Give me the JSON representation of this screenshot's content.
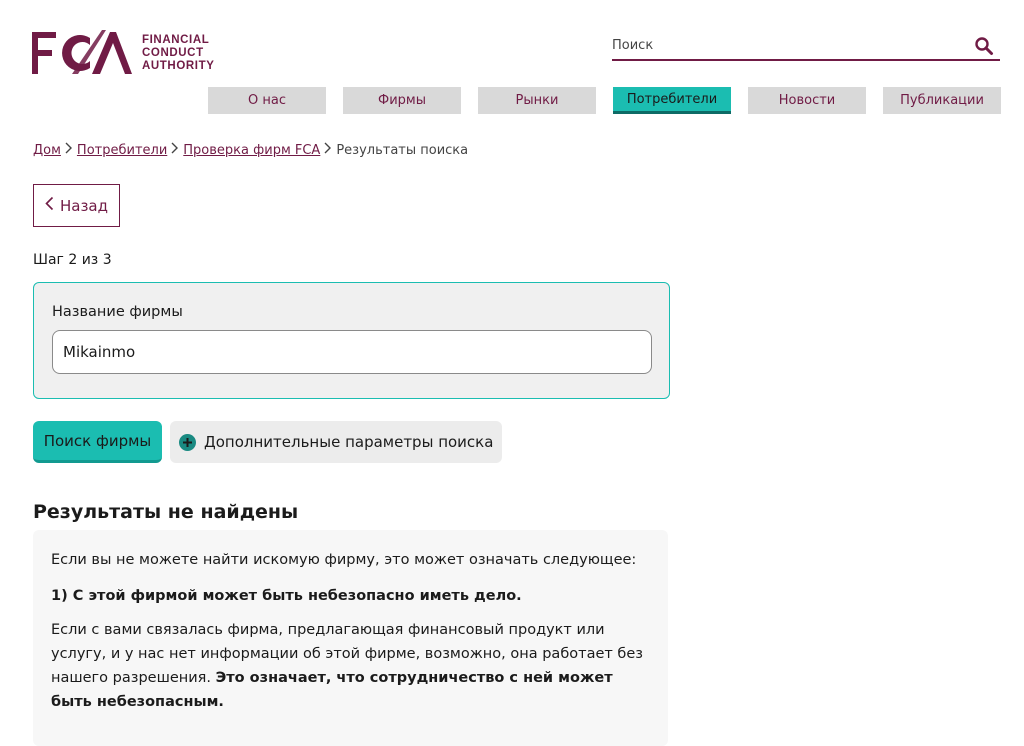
{
  "header": {
    "logo": {
      "mark": "FCA",
      "lines": [
        "FINANCIAL",
        "CONDUCT",
        "AUTHORITY"
      ]
    },
    "search": {
      "placeholder": "Поиск",
      "icon": "search-icon"
    }
  },
  "nav": [
    {
      "label": "О нас",
      "active": false
    },
    {
      "label": "Фирмы",
      "active": false
    },
    {
      "label": "Рынки",
      "active": false
    },
    {
      "label": "Потребители",
      "active": true
    },
    {
      "label": "Новости",
      "active": false
    },
    {
      "label": "Публикации",
      "active": false
    }
  ],
  "breadcrumb": {
    "items": [
      "Дом",
      "Потребители",
      "Проверка фирм FCA"
    ],
    "current": "Результаты поиска"
  },
  "back_label": "Назад",
  "step_text": "Шаг 2 из 3",
  "form": {
    "label": "Название фирмы",
    "value": "Mikainmo"
  },
  "buttons": {
    "search": "Поиск фирмы",
    "advanced": "Дополнительные параметры поиска"
  },
  "results": {
    "title": "Результаты не найдены",
    "intro": "Если вы не можете найти искомую фирму, это может означать следующее:",
    "point1": "1) С этой фирмой может быть небезопасно иметь дело.",
    "para_text": "Если с вами связалась фирма, предлагающая финансовый продукт или услугу, и у нас нет информации об этой фирме, возможно, она работает без нашего разрешения. ",
    "para_bold": "Это означает, что сотрудничество с ней может быть небезопасным."
  },
  "colors": {
    "brand": "#701b45",
    "accent": "#1bbdb1",
    "nav_inactive": "#d9d9d9"
  }
}
